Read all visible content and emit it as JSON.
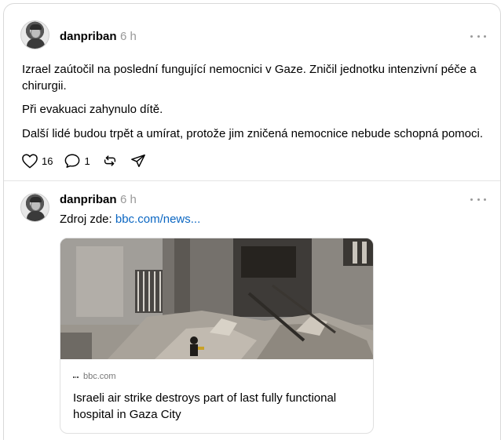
{
  "posts": [
    {
      "username": "danpriban",
      "time": "6 h",
      "paragraphs": [
        "Izrael zaútočil na poslední fungující nemocnici v Gaze. Zničil jednotku intenzivní péče a chirurgii.",
        "Při evakuaci zahynulo dítě.",
        "Další lidé budou trpět a umírat, protože jim zničená nemocnice nebude schopná pomoci."
      ],
      "likes": "16",
      "replies": "1"
    },
    {
      "username": "danpriban",
      "time": "6 h",
      "source_prefix": "Zdroj zde: ",
      "source_link": "bbc.com/news...",
      "link_card": {
        "domain": "bbc.com",
        "title": "Israeli air strike destroys part of last fully functional hospital in Gaza City"
      }
    }
  ]
}
